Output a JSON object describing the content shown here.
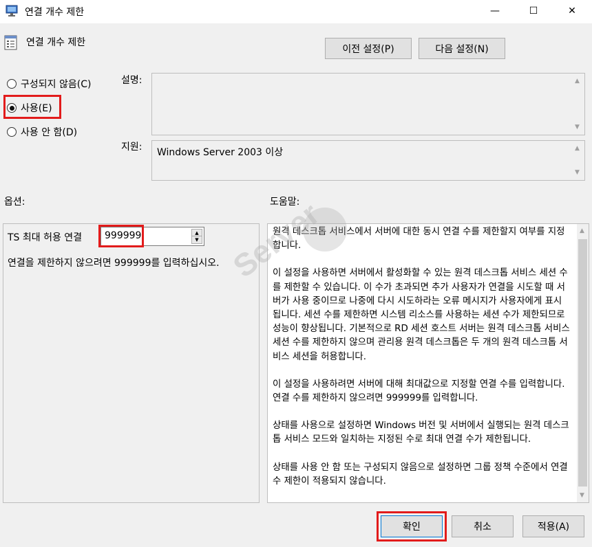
{
  "window": {
    "title": "연결 개수 제한",
    "minimize_glyph": "—",
    "maximize_glyph": "☐",
    "close_glyph": "✕"
  },
  "header": {
    "setting_title": "연결 개수 제한",
    "prev_button": "이전 설정(P)",
    "next_button": "다음 설정(N)"
  },
  "state": {
    "options": [
      {
        "label": "구성되지 않음(C)",
        "selected": false
      },
      {
        "label": "사용(E)",
        "selected": true
      },
      {
        "label": "사용 안 함(D)",
        "selected": false
      }
    ]
  },
  "labels": {
    "description": "설명:",
    "supported_on": "지원:",
    "options": "옵션:",
    "help": "도움말:"
  },
  "supported_text": "Windows Server 2003 이상",
  "options_panel": {
    "ts_label": "TS 최대 허용 연결",
    "ts_value": "999999",
    "hint": "연결을 제한하지 않으려면 999999를 입력하십시오."
  },
  "help": {
    "paragraphs": [
      "원격 데스크톱 서비스에서 서버에 대한 동시 연결 수를 제한할지 여부를 지정합니다.",
      "이 설정을 사용하면 서버에서 활성화할 수 있는 원격 데스크톱 서비스 세션 수를 제한할 수 있습니다. 이 수가 초과되면 추가 사용자가 연결을 시도할 때 서버가 사용 중이므로 나중에 다시 시도하라는 오류 메시지가 사용자에게 표시됩니다. 세션 수를 제한하면 시스템 리소스를 사용하는 세션 수가 제한되므로 성능이 향상됩니다. 기본적으로 RD 세션 호스트 서버는 원격 데스크톱 서비스 세션 수를 제한하지 않으며 관리용 원격 데스크톱은 두 개의 원격 데스크톱 서비스 세션을 허용합니다.",
      "이 설정을 사용하려면 서버에 대해 최대값으로 지정할 연결 수를 입력합니다. 연결 수를 제한하지 않으려면 999999를 입력합니다.",
      "상태를 사용으로 설정하면 Windows 버전 및 서버에서 실행되는 원격 데스크톱 서비스 모드와 일치하는 지정된 수로 최대 연결 수가 제한됩니다.",
      "상태를 사용 안 함 또는 구성되지 않음으로 설정하면 그룹 정책 수준에서 연결 수 제한이 적용되지 않습니다."
    ]
  },
  "footer": {
    "ok": "확인",
    "cancel": "취소",
    "apply": "적용(A)"
  },
  "watermark": "Server",
  "colors": {
    "highlight": "#e21b1b",
    "background": "#f0f0f0"
  }
}
